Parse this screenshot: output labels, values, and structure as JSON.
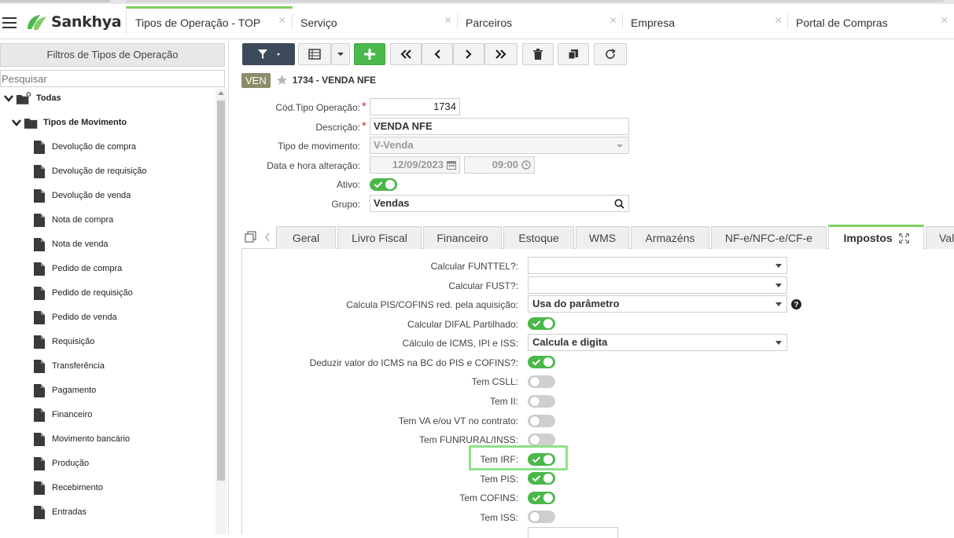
{
  "app": {
    "brand": "Sankhya"
  },
  "top_tabs": [
    {
      "label": "Tipos de Operação - TOP",
      "active": true
    },
    {
      "label": "Serviço"
    },
    {
      "label": "Parceiros"
    },
    {
      "label": "Empresa"
    },
    {
      "label": "Portal de Compras"
    }
  ],
  "filter_panel": {
    "title": "Filtros de Tipos de Operação",
    "search_placeholder": "Pesquisar",
    "root": "Todas",
    "group": "Tipos de Movimento",
    "items": [
      "Devolução de compra",
      "Devolução de requisição",
      "Devolução de venda",
      "Nota de compra",
      "Nota de venda",
      "Pedido de compra",
      "Pedido de requisição",
      "Pedido de venda",
      "Requisição",
      "Transferência",
      "Pagamento",
      "Financeiro",
      "Movimento bancário",
      "Produção",
      "Recebimento",
      "Entradas"
    ]
  },
  "record": {
    "badge": "VEN",
    "title": "1734 - VENDA NFE"
  },
  "form": {
    "cod_label": "Cód.Tipo Operação:",
    "cod_value": "1734",
    "desc_label": "Descrição:",
    "desc_value": "VENDA NFE",
    "tipo_label": "Tipo de movimento:",
    "tipo_value": "V-Venda",
    "data_label": "Data e hora alteração:",
    "data_value": "12/09/2023",
    "hora_value": "09:00",
    "ativo_label": "Ativo:",
    "ativo_on": true,
    "grupo_label": "Grupo:",
    "grupo_value": "Vendas"
  },
  "detail_tabs": [
    "Geral",
    "Livro Fiscal",
    "Financeiro",
    "Estoque",
    "WMS",
    "Armazéns",
    "NF-e/NFC-e/CF-e",
    "Impostos",
    "Val"
  ],
  "active_detail_tab": "Impostos",
  "impostos": {
    "funttel_label": "Calcular FUNTTEL?:",
    "funttel_value": "",
    "fust_label": "Calcular FUST?:",
    "fust_value": "",
    "pis_red_label": "Calcula PIS/COFINS red. pela aquisição:",
    "pis_red_value": "Usa do parâmetro",
    "difal_label": "Calcular DIFAL Partilhado:",
    "difal_on": true,
    "calc_icms_label": "Cálculo de ICMS, IPI e ISS:",
    "calc_icms_value": "Calcula e digita",
    "deduzir_label": "Deduzir valor do ICMS na BC do PIS e COFINS?:",
    "deduzir_on": true,
    "csll_label": "Tem CSLL:",
    "csll_on": false,
    "ii_label": "Tem II:",
    "ii_on": false,
    "vavt_label": "Tem VA e/ou VT no contrato:",
    "vavt_on": false,
    "funrural_label": "Tem FUNRURAL/INSS:",
    "funrural_on": false,
    "irf_label": "Tem IRF:",
    "irf_on": true,
    "pis_label": "Tem PIS:",
    "pis_on": true,
    "cofins_label": "Tem COFINS:",
    "cofins_on": true,
    "iss_label": "Tem ISS:",
    "iss_on": false
  },
  "colors": {
    "accent_green": "#4ab84a",
    "tab_highlight": "#7fcf64",
    "toolbar_dark": "#3d4a5a",
    "highlight_box": "#8ee08a"
  }
}
